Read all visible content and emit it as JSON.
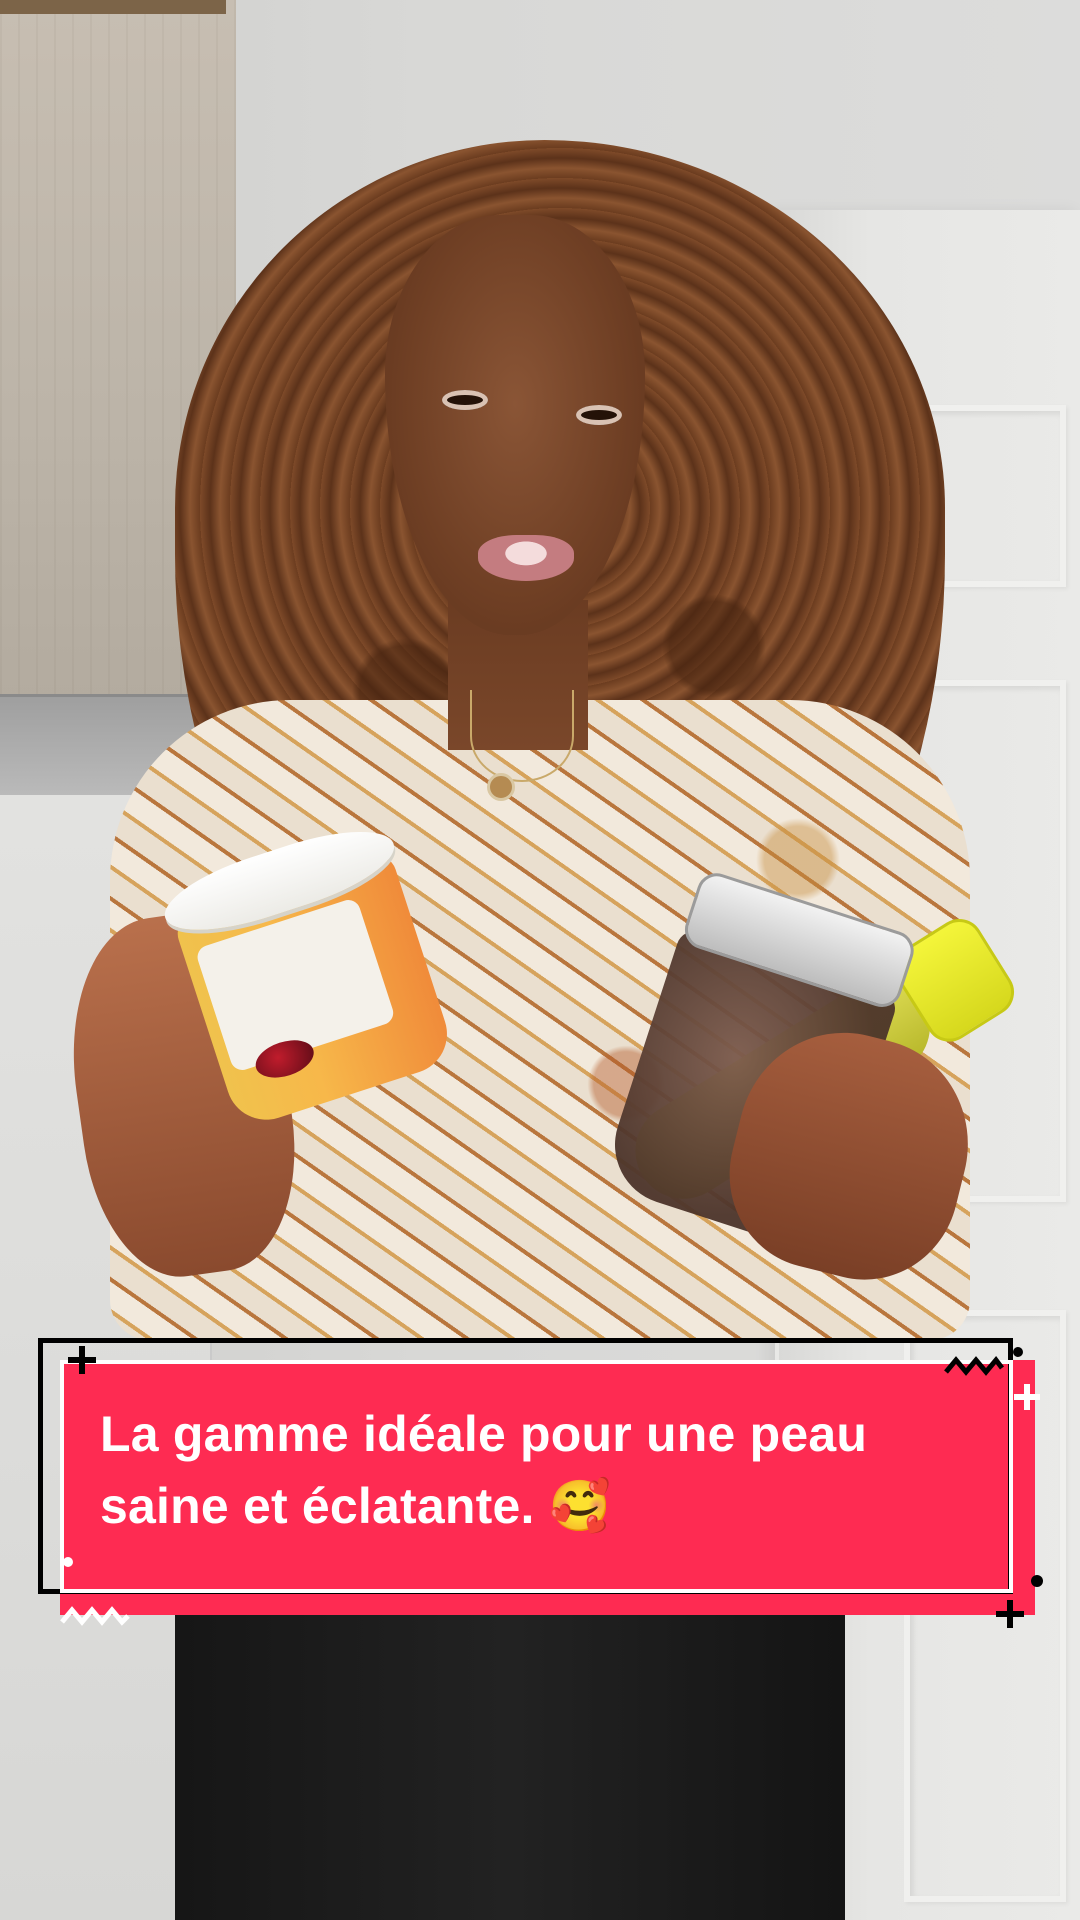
{
  "caption": {
    "line1": "La gamme idéale pour une peau",
    "line2": "saine et éclatante. 🥰"
  },
  "colors": {
    "caption_background": "#fe2b52",
    "caption_text": "#ffffff",
    "caption_frame_outer": "#000000",
    "caption_frame_inner": "#ffffff"
  },
  "icons": {
    "plus": "plus-icon",
    "zigzag": "zigzag-icon",
    "dot": "dot-icon",
    "emoji": "smiling-face-with-hearts"
  }
}
